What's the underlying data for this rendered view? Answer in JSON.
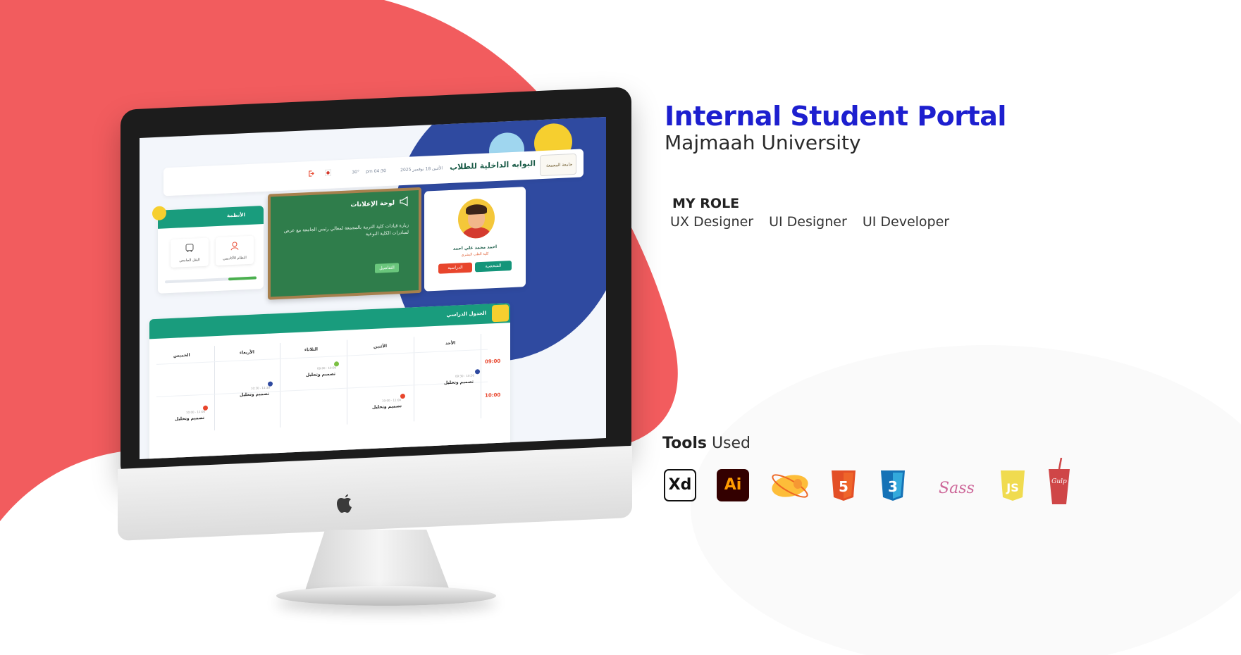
{
  "header": {
    "title": "Internal Student Portal",
    "subtitle": "Majmaah University"
  },
  "role": {
    "heading": "MY ROLE",
    "items": [
      "UX Designer",
      "UI Designer",
      "UI Developer"
    ]
  },
  "tools": {
    "heading_bold": "Tools",
    "heading_rest": " Used",
    "items": [
      {
        "label": "Xd",
        "icon": "adobe-xd-icon"
      },
      {
        "label": "Ai",
        "icon": "adobe-illustrator-icon"
      },
      {
        "label": "",
        "icon": "zeplin-icon"
      },
      {
        "label": "5",
        "icon": "html5-icon"
      },
      {
        "label": "3",
        "icon": "css3-icon"
      },
      {
        "label": "Sass",
        "icon": "sass-icon"
      },
      {
        "label": "JS",
        "icon": "javascript-icon"
      },
      {
        "label": "Gulp",
        "icon": "gulp-icon"
      }
    ]
  },
  "colors": {
    "accent_blue": "#1d1fcf",
    "blob_red": "#f25c5e",
    "portal_green": "#199c7d",
    "portal_blue": "#2f4aa0",
    "portal_yellow": "#f6cf2f",
    "portal_red": "#e8452c"
  },
  "portal": {
    "title": "البوابه الداخلية للطلاب",
    "logo_text": "جامعة المجمعة",
    "date": "الأثنين 18 نوفمبر 2025",
    "time": "04:30 pm",
    "temp": "30°",
    "profile": {
      "name": "احمد محمد علي احمد",
      "dept": "كلية الطب البشري",
      "btn_personal": "الشخصية",
      "btn_study": "الدراسية"
    },
    "announcements": {
      "title": "لوحة الإعلانات",
      "body": "زيارة قيادات كلية التربية بالمجمعة لمعالي رئيس الجامعة مع عرض لمبادرات الكلية النوعية",
      "button": "التفاصيل"
    },
    "systems": {
      "title": "الأنظمة",
      "items": [
        "النظام الأكاديمي",
        "النقل الجامعي"
      ]
    },
    "schedule": {
      "title": "الجدول الدراسي",
      "days": [
        "الأحد",
        "الأثنين",
        "الثلاثاء",
        "الأربعاء",
        "الخميس"
      ],
      "times": [
        "09:00",
        "10:00"
      ],
      "event": "تصميم وتحليل",
      "event_times": [
        "09:30 - 10:30",
        "10:00 - 11:00",
        "09:00 - 10:00",
        "10:30 - 11:30",
        "10:00 - 11:00"
      ]
    }
  }
}
